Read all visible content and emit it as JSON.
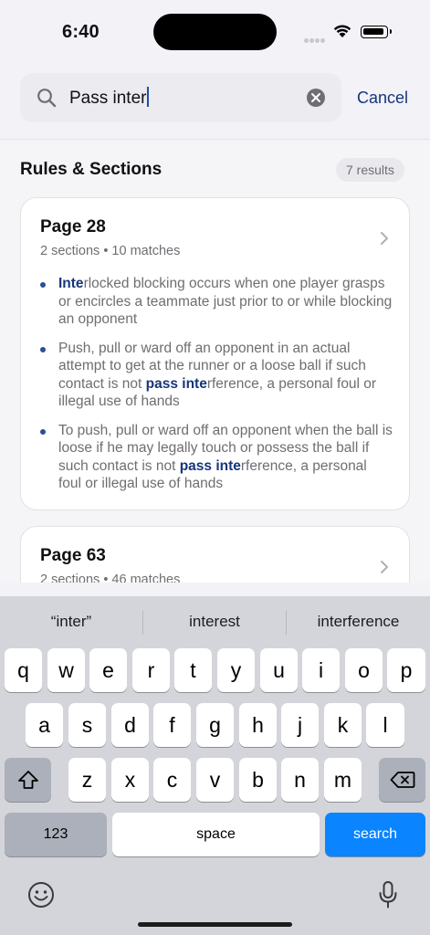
{
  "status": {
    "time": "6:40"
  },
  "search": {
    "query": "Pass inter",
    "cancel_label": "Cancel"
  },
  "results": {
    "section_title": "Rules & Sections",
    "count_label": "7 results",
    "cards": [
      {
        "title": "Page 28",
        "meta": "2 sections • 10 matches",
        "bullets": [
          {
            "highlight": "Inte",
            "pre": "",
            "post": "rlocked blocking occurs when one player grasps or encircles a teammate just prior to or while blocking an opponent"
          },
          {
            "pre": "Push, pull or ward off an opponent in an actual attempt to get at the runner or a loose ball if such contact is not ",
            "highlight": "pass inte",
            "post": "rference, a personal foul or illegal use of hands"
          },
          {
            "pre": "To push, pull or ward off an opponent when the ball is loose if he may legally touch or possess the ball if such contact is not ",
            "highlight": "pass inte",
            "post": "rference, a personal foul or illegal use of hands"
          }
        ]
      },
      {
        "title": "Page 63",
        "meta": "2 sections • 46 matches"
      }
    ]
  },
  "keyboard": {
    "suggestions": [
      "“inter”",
      "interest",
      "interference"
    ],
    "row1": [
      "q",
      "w",
      "e",
      "r",
      "t",
      "y",
      "u",
      "i",
      "o",
      "p"
    ],
    "row2": [
      "a",
      "s",
      "d",
      "f",
      "g",
      "h",
      "j",
      "k",
      "l"
    ],
    "row3": [
      "z",
      "x",
      "c",
      "v",
      "b",
      "n",
      "m"
    ],
    "numbers_label": "123",
    "space_label": "space",
    "search_label": "search"
  },
  "colors": {
    "accent": "#15367a",
    "search_key": "#0a84ff"
  }
}
